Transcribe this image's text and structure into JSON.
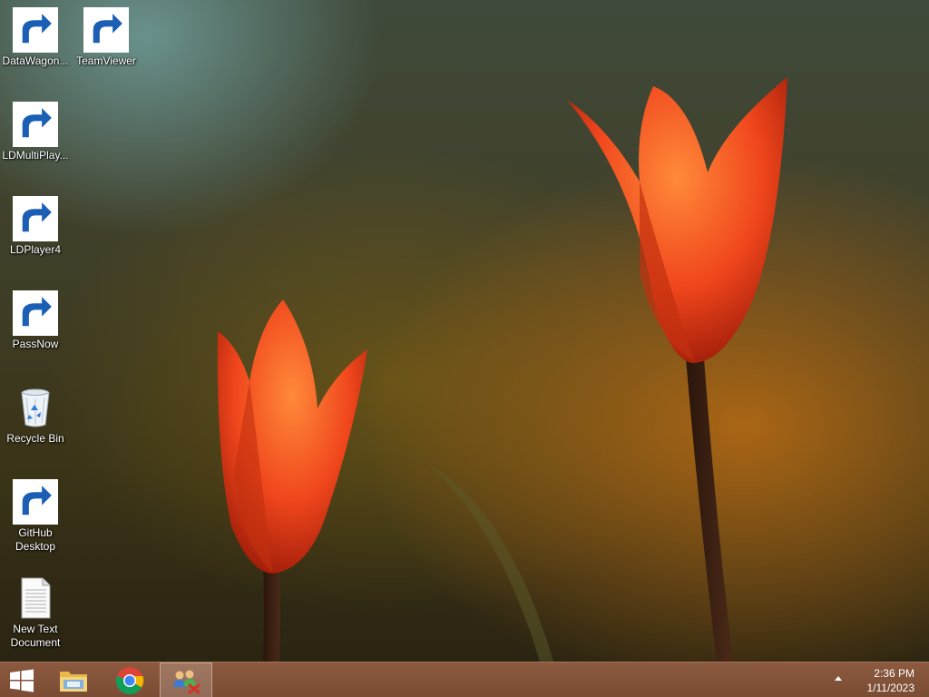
{
  "desktop_icons": [
    {
      "label": "DataWagon...",
      "icon": "datawagon-icon",
      "shortcut": true
    },
    {
      "label": "TeamViewer",
      "icon": "teamviewer-icon",
      "shortcut": true
    },
    {
      "label": "LDMultiPlay...",
      "icon": "ldmultiplayer-icon",
      "shortcut": true
    },
    {
      "label": "LDPlayer4",
      "icon": "ldplayer-icon",
      "shortcut": true
    },
    {
      "label": "PassNow",
      "icon": "passnow-icon",
      "shortcut": true
    },
    {
      "label": "Recycle Bin",
      "icon": "recycle-bin-icon",
      "shortcut": false
    },
    {
      "label": "GitHub Desktop",
      "icon": "github-icon",
      "shortcut": true
    },
    {
      "label": "New Text Document",
      "icon": "text-document-icon",
      "shortcut": false
    }
  ],
  "taskbar": {
    "buttons": [
      {
        "name": "start-button",
        "icon": "windows-logo-icon"
      },
      {
        "name": "file-explorer-button",
        "icon": "folder-icon"
      },
      {
        "name": "chrome-button",
        "icon": "chrome-icon"
      },
      {
        "name": "network-app-button",
        "icon": "network-users-icon",
        "active": true
      }
    ],
    "tray": {
      "show_hidden_icon": "chevron-up-icon",
      "time": "2:36 PM",
      "date": "1/11/2023"
    }
  },
  "colors": {
    "taskbar": "#7a4b33",
    "tulip": "#e8401a"
  }
}
